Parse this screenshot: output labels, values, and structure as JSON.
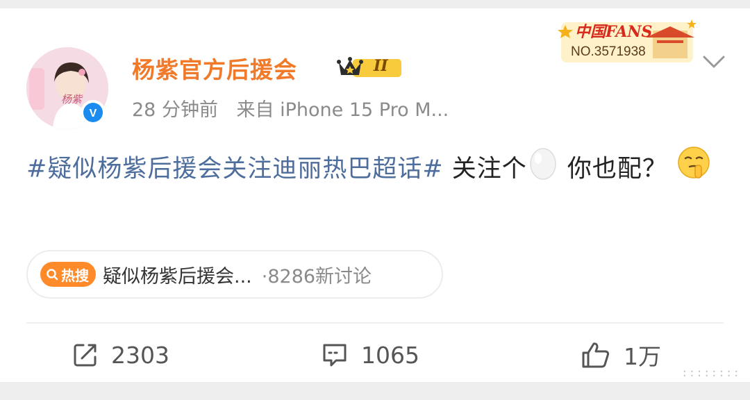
{
  "post": {
    "author": {
      "name": "杨紫官方后援会",
      "vip_level": "II",
      "fans_badge_title": "中国FANS",
      "fans_badge_number": "NO.3571938",
      "avatar_text": "杨紫"
    },
    "meta": {
      "time": "28 分钟前",
      "source": "来自 iPhone 15 Pro M..."
    },
    "content": {
      "topic": "#疑似杨紫后援会关注迪丽热巴超话#",
      "text_1": " 关注个",
      "text_2": " 你也配？",
      "emojis": [
        "egg-emoji",
        "shush-emoji"
      ]
    },
    "hot_search": {
      "badge": "热搜",
      "title": "疑似杨紫后援会...",
      "count": "·8286新讨论"
    },
    "actions": {
      "repost": "2303",
      "comment": "1065",
      "like": "1万"
    }
  },
  "colors": {
    "username": "#f07a2a",
    "topic": "#4d6d9c",
    "hot_badge": "#ff8a2a",
    "verified": "#1a8cf0"
  }
}
